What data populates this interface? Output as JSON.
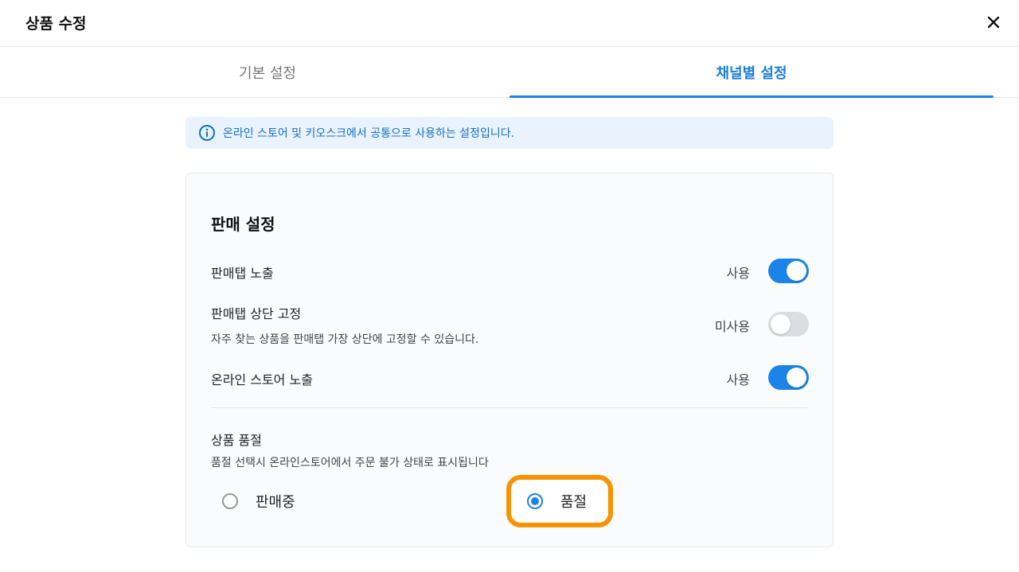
{
  "header": {
    "title": "상품 수정"
  },
  "tabs": [
    {
      "label": "기본 설정",
      "active": false
    },
    {
      "label": "채널별 설정",
      "active": true
    }
  ],
  "notice": {
    "text": "온라인 스토어 및 키오스크에서 공통으로 사용하는 설정입니다."
  },
  "sales_settings": {
    "title": "판매 설정",
    "rows": [
      {
        "label": "판매탭 노출",
        "status": "사용",
        "enabled": true
      },
      {
        "label": "판매탭 상단 고정",
        "description": "자주 찾는 상품을 판매탭 가장 상단에 고정할 수 있습니다.",
        "status": "미사용",
        "enabled": false
      },
      {
        "label": "온라인 스토어 노출",
        "status": "사용",
        "enabled": true
      }
    ],
    "soldout": {
      "label": "상품 품절",
      "description": "품절 선택시 온라인스토어에서 주문 불가 상태로 표시됩니다",
      "options": [
        {
          "label": "판매중",
          "selected": false
        },
        {
          "label": "품절",
          "selected": true
        }
      ]
    }
  },
  "colors": {
    "accent": "#1a84e8",
    "highlight": "#f59400"
  }
}
